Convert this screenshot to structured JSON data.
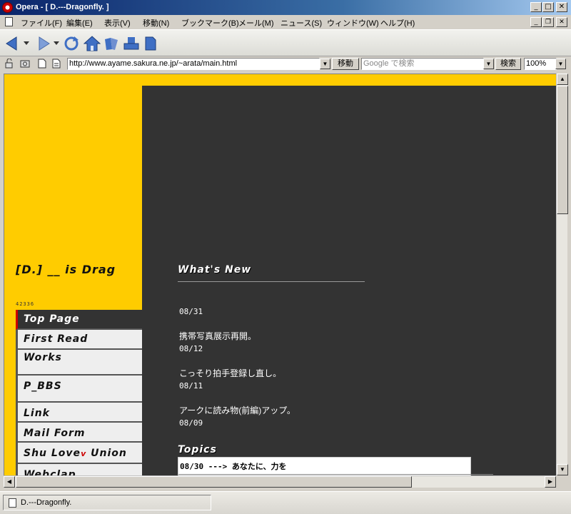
{
  "window": {
    "title": "Opera - [ D.---Dragonfly. ]",
    "minimize_glyph": "_",
    "maximize_glyph": "□",
    "close_glyph": "✕",
    "restore_glyph": "❐"
  },
  "menubar": {
    "items": [
      "ファイル(F)",
      "編集(E)",
      "表示(V)",
      "移動(N)",
      "ブックマーク(B)",
      "メール(M)",
      "ニュース(S)",
      "ウィンドウ(W)",
      "ヘルプ(H)"
    ]
  },
  "toolbar": {
    "icons": [
      "back-icon",
      "forward-icon",
      "reload-icon",
      "home-icon",
      "hotlist-icon",
      "print-icon",
      "page-icon"
    ]
  },
  "addressbar": {
    "url": "http://www.ayame.sakura.ne.jp/~arata/main.html",
    "go_label": "移動",
    "search_placeholder": "Google で検索",
    "search_button": "検索",
    "zoom": "100%"
  },
  "page": {
    "site_title": "[D.] __ is Drag",
    "counter": "42336",
    "nav": [
      {
        "label": "Top Page",
        "active": true
      },
      {
        "label": "First Read"
      },
      {
        "label": "Works"
      },
      {
        "label": "P_BBS"
      },
      {
        "label": "Link"
      },
      {
        "label": "Mail Form"
      },
      {
        "label_pre": "Shu Love",
        "label_mark": "v",
        "label_post": " Union"
      },
      {
        "label": "Webclap"
      }
    ],
    "news_heading": "What's New",
    "news": [
      {
        "date": "08/31",
        "text": "携帯写真展示再開。"
      },
      {
        "date": "08/12",
        "text": "こっそり拍手登録し直し。"
      },
      {
        "date": "08/11",
        "text": "アークに読み物(前編)アップ。"
      },
      {
        "date": "08/09",
        "text": ""
      }
    ],
    "topics_heading": "Topics",
    "topics_row": "08/30 ---> あなたに、力を"
  },
  "statusbar": {
    "text": "D.---Dragonfly."
  },
  "colors": {
    "page_bg": "#ffcc00",
    "panel_bg": "#333333",
    "accent": "#cc0000"
  }
}
